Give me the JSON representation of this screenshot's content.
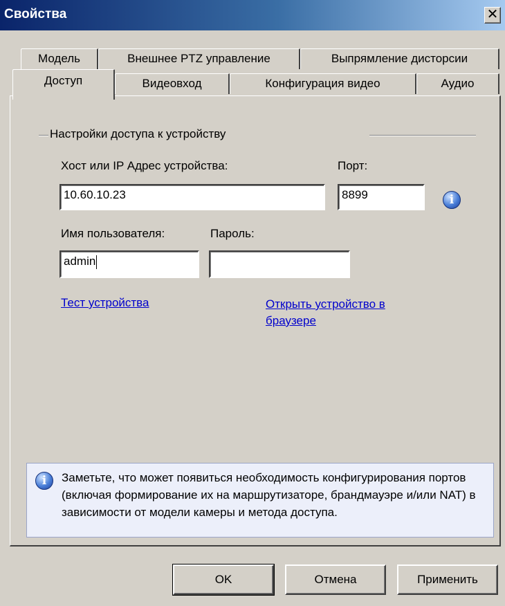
{
  "window": {
    "title": "Свойства",
    "close_glyph": "✕"
  },
  "tabs": {
    "row1": [
      "Модель",
      "Внешнее PTZ управление",
      "Выпрямление дисторсии"
    ],
    "row2": [
      "Доступ",
      "Видеовход",
      "Конфигурация видео",
      "Аудио"
    ],
    "active": "Доступ"
  },
  "access": {
    "group_title": "Настройки доступа к устройству",
    "host_label": "Хост или IP Адрес устройства:",
    "port_label": "Порт:",
    "host_value": "10.60.10.23",
    "port_value": "8899",
    "username_label": "Имя пользователя:",
    "password_label": "Пароль:",
    "username_value": "admin",
    "password_value": "",
    "test_link": "Тест устройства",
    "open_link": "Открыть устройство в браузере"
  },
  "note": {
    "text": "Заметьте, что может появиться необходимость конфигурирования портов (включая формирование их на маршрутизаторе, брандмауэре и/или NAT) в зависимости от модели камеры и метода доступа."
  },
  "buttons": {
    "ok": "OK",
    "cancel": "Отмена",
    "apply": "Применить"
  },
  "icons": {
    "info": "info-icon",
    "info_glyph": "i"
  },
  "colors": {
    "title_start": "#0a246a",
    "title_end": "#a6caf0",
    "link": "#0000cc",
    "note_bg": "#eceffa"
  }
}
